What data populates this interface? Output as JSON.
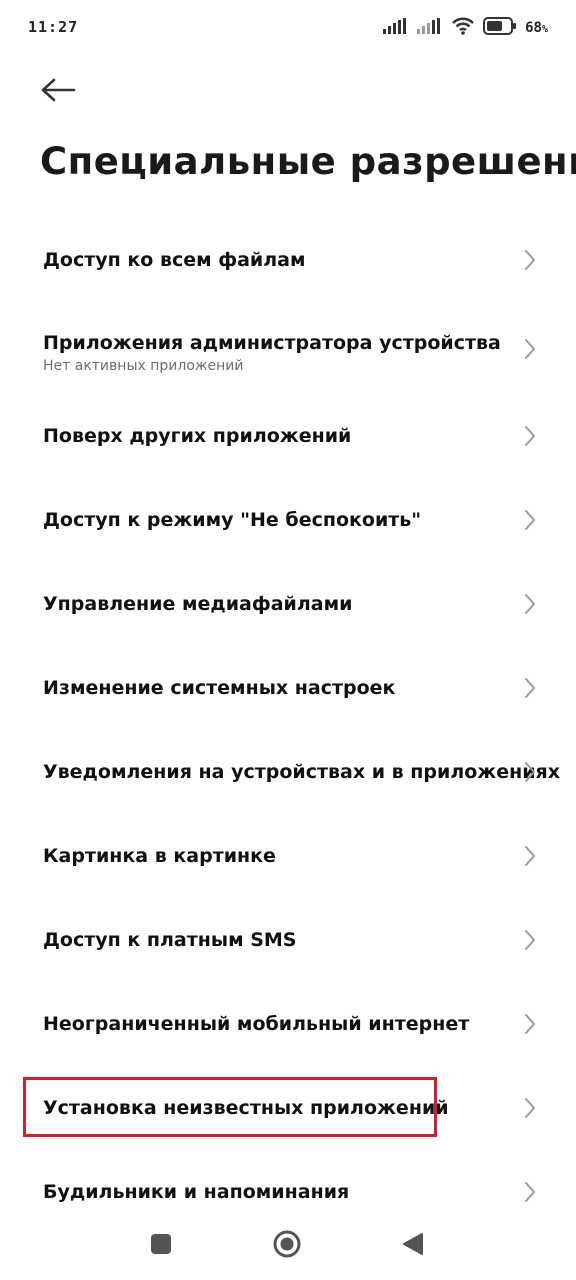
{
  "status_bar": {
    "time": "11:27",
    "battery_level": "68",
    "battery_unit": "%",
    "icons": [
      "signal-icon",
      "signal-icon",
      "wifi-icon",
      "battery-icon"
    ]
  },
  "header": {
    "back_icon": "arrow-left-icon",
    "title": "Специальные разрешения"
  },
  "permissions": [
    {
      "label": "Доступ ко всем файлам"
    },
    {
      "label": "Приложения администратора устройства",
      "subtitle": "Нет активных приложений"
    },
    {
      "label": "Поверх других приложений"
    },
    {
      "label": "Доступ к режиму \"Не беспокоить\""
    },
    {
      "label": "Управление медиафайлами"
    },
    {
      "label": "Изменение системных настроек"
    },
    {
      "label": "Уведомления на устройствах и в приложениях"
    },
    {
      "label": "Картинка в картинке"
    },
    {
      "label": "Доступ к платным SMS"
    },
    {
      "label": "Неограниченный мобильный интернет"
    },
    {
      "label": "Установка неизвестных приложений",
      "highlighted": true
    },
    {
      "label": "Будильники и напоминания"
    }
  ],
  "nav_bar": {
    "icons": [
      "recents-icon",
      "home-icon",
      "back-icon"
    ]
  },
  "colors": {
    "highlight": "#d0202a",
    "text": "#111111",
    "subtitle": "#6e6e6e",
    "chevron": "#9a9a9a"
  }
}
